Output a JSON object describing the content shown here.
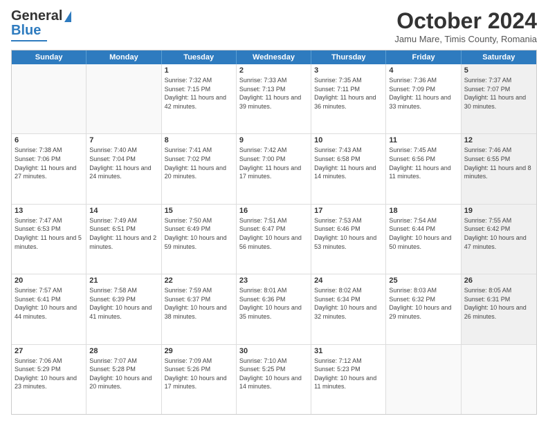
{
  "logo": {
    "line1": "General",
    "line2": "Blue"
  },
  "title": "October 2024",
  "subtitle": "Jamu Mare, Timis County, Romania",
  "days": [
    "Sunday",
    "Monday",
    "Tuesday",
    "Wednesday",
    "Thursday",
    "Friday",
    "Saturday"
  ],
  "weeks": [
    [
      {
        "day": "",
        "sunrise": "",
        "sunset": "",
        "daylight": "",
        "shaded": false,
        "empty": true
      },
      {
        "day": "",
        "sunrise": "",
        "sunset": "",
        "daylight": "",
        "shaded": false,
        "empty": true
      },
      {
        "day": "1",
        "sunrise": "Sunrise: 7:32 AM",
        "sunset": "Sunset: 7:15 PM",
        "daylight": "Daylight: 11 hours and 42 minutes.",
        "shaded": false,
        "empty": false
      },
      {
        "day": "2",
        "sunrise": "Sunrise: 7:33 AM",
        "sunset": "Sunset: 7:13 PM",
        "daylight": "Daylight: 11 hours and 39 minutes.",
        "shaded": false,
        "empty": false
      },
      {
        "day": "3",
        "sunrise": "Sunrise: 7:35 AM",
        "sunset": "Sunset: 7:11 PM",
        "daylight": "Daylight: 11 hours and 36 minutes.",
        "shaded": false,
        "empty": false
      },
      {
        "day": "4",
        "sunrise": "Sunrise: 7:36 AM",
        "sunset": "Sunset: 7:09 PM",
        "daylight": "Daylight: 11 hours and 33 minutes.",
        "shaded": false,
        "empty": false
      },
      {
        "day": "5",
        "sunrise": "Sunrise: 7:37 AM",
        "sunset": "Sunset: 7:07 PM",
        "daylight": "Daylight: 11 hours and 30 minutes.",
        "shaded": true,
        "empty": false
      }
    ],
    [
      {
        "day": "6",
        "sunrise": "Sunrise: 7:38 AM",
        "sunset": "Sunset: 7:06 PM",
        "daylight": "Daylight: 11 hours and 27 minutes.",
        "shaded": false,
        "empty": false
      },
      {
        "day": "7",
        "sunrise": "Sunrise: 7:40 AM",
        "sunset": "Sunset: 7:04 PM",
        "daylight": "Daylight: 11 hours and 24 minutes.",
        "shaded": false,
        "empty": false
      },
      {
        "day": "8",
        "sunrise": "Sunrise: 7:41 AM",
        "sunset": "Sunset: 7:02 PM",
        "daylight": "Daylight: 11 hours and 20 minutes.",
        "shaded": false,
        "empty": false
      },
      {
        "day": "9",
        "sunrise": "Sunrise: 7:42 AM",
        "sunset": "Sunset: 7:00 PM",
        "daylight": "Daylight: 11 hours and 17 minutes.",
        "shaded": false,
        "empty": false
      },
      {
        "day": "10",
        "sunrise": "Sunrise: 7:43 AM",
        "sunset": "Sunset: 6:58 PM",
        "daylight": "Daylight: 11 hours and 14 minutes.",
        "shaded": false,
        "empty": false
      },
      {
        "day": "11",
        "sunrise": "Sunrise: 7:45 AM",
        "sunset": "Sunset: 6:56 PM",
        "daylight": "Daylight: 11 hours and 11 minutes.",
        "shaded": false,
        "empty": false
      },
      {
        "day": "12",
        "sunrise": "Sunrise: 7:46 AM",
        "sunset": "Sunset: 6:55 PM",
        "daylight": "Daylight: 11 hours and 8 minutes.",
        "shaded": true,
        "empty": false
      }
    ],
    [
      {
        "day": "13",
        "sunrise": "Sunrise: 7:47 AM",
        "sunset": "Sunset: 6:53 PM",
        "daylight": "Daylight: 11 hours and 5 minutes.",
        "shaded": false,
        "empty": false
      },
      {
        "day": "14",
        "sunrise": "Sunrise: 7:49 AM",
        "sunset": "Sunset: 6:51 PM",
        "daylight": "Daylight: 11 hours and 2 minutes.",
        "shaded": false,
        "empty": false
      },
      {
        "day": "15",
        "sunrise": "Sunrise: 7:50 AM",
        "sunset": "Sunset: 6:49 PM",
        "daylight": "Daylight: 10 hours and 59 minutes.",
        "shaded": false,
        "empty": false
      },
      {
        "day": "16",
        "sunrise": "Sunrise: 7:51 AM",
        "sunset": "Sunset: 6:47 PM",
        "daylight": "Daylight: 10 hours and 56 minutes.",
        "shaded": false,
        "empty": false
      },
      {
        "day": "17",
        "sunrise": "Sunrise: 7:53 AM",
        "sunset": "Sunset: 6:46 PM",
        "daylight": "Daylight: 10 hours and 53 minutes.",
        "shaded": false,
        "empty": false
      },
      {
        "day": "18",
        "sunrise": "Sunrise: 7:54 AM",
        "sunset": "Sunset: 6:44 PM",
        "daylight": "Daylight: 10 hours and 50 minutes.",
        "shaded": false,
        "empty": false
      },
      {
        "day": "19",
        "sunrise": "Sunrise: 7:55 AM",
        "sunset": "Sunset: 6:42 PM",
        "daylight": "Daylight: 10 hours and 47 minutes.",
        "shaded": true,
        "empty": false
      }
    ],
    [
      {
        "day": "20",
        "sunrise": "Sunrise: 7:57 AM",
        "sunset": "Sunset: 6:41 PM",
        "daylight": "Daylight: 10 hours and 44 minutes.",
        "shaded": false,
        "empty": false
      },
      {
        "day": "21",
        "sunrise": "Sunrise: 7:58 AM",
        "sunset": "Sunset: 6:39 PM",
        "daylight": "Daylight: 10 hours and 41 minutes.",
        "shaded": false,
        "empty": false
      },
      {
        "day": "22",
        "sunrise": "Sunrise: 7:59 AM",
        "sunset": "Sunset: 6:37 PM",
        "daylight": "Daylight: 10 hours and 38 minutes.",
        "shaded": false,
        "empty": false
      },
      {
        "day": "23",
        "sunrise": "Sunrise: 8:01 AM",
        "sunset": "Sunset: 6:36 PM",
        "daylight": "Daylight: 10 hours and 35 minutes.",
        "shaded": false,
        "empty": false
      },
      {
        "day": "24",
        "sunrise": "Sunrise: 8:02 AM",
        "sunset": "Sunset: 6:34 PM",
        "daylight": "Daylight: 10 hours and 32 minutes.",
        "shaded": false,
        "empty": false
      },
      {
        "day": "25",
        "sunrise": "Sunrise: 8:03 AM",
        "sunset": "Sunset: 6:32 PM",
        "daylight": "Daylight: 10 hours and 29 minutes.",
        "shaded": false,
        "empty": false
      },
      {
        "day": "26",
        "sunrise": "Sunrise: 8:05 AM",
        "sunset": "Sunset: 6:31 PM",
        "daylight": "Daylight: 10 hours and 26 minutes.",
        "shaded": true,
        "empty": false
      }
    ],
    [
      {
        "day": "27",
        "sunrise": "Sunrise: 7:06 AM",
        "sunset": "Sunset: 5:29 PM",
        "daylight": "Daylight: 10 hours and 23 minutes.",
        "shaded": false,
        "empty": false
      },
      {
        "day": "28",
        "sunrise": "Sunrise: 7:07 AM",
        "sunset": "Sunset: 5:28 PM",
        "daylight": "Daylight: 10 hours and 20 minutes.",
        "shaded": false,
        "empty": false
      },
      {
        "day": "29",
        "sunrise": "Sunrise: 7:09 AM",
        "sunset": "Sunset: 5:26 PM",
        "daylight": "Daylight: 10 hours and 17 minutes.",
        "shaded": false,
        "empty": false
      },
      {
        "day": "30",
        "sunrise": "Sunrise: 7:10 AM",
        "sunset": "Sunset: 5:25 PM",
        "daylight": "Daylight: 10 hours and 14 minutes.",
        "shaded": false,
        "empty": false
      },
      {
        "day": "31",
        "sunrise": "Sunrise: 7:12 AM",
        "sunset": "Sunset: 5:23 PM",
        "daylight": "Daylight: 10 hours and 11 minutes.",
        "shaded": false,
        "empty": false
      },
      {
        "day": "",
        "sunrise": "",
        "sunset": "",
        "daylight": "",
        "shaded": false,
        "empty": true
      },
      {
        "day": "",
        "sunrise": "",
        "sunset": "",
        "daylight": "",
        "shaded": true,
        "empty": true
      }
    ]
  ]
}
